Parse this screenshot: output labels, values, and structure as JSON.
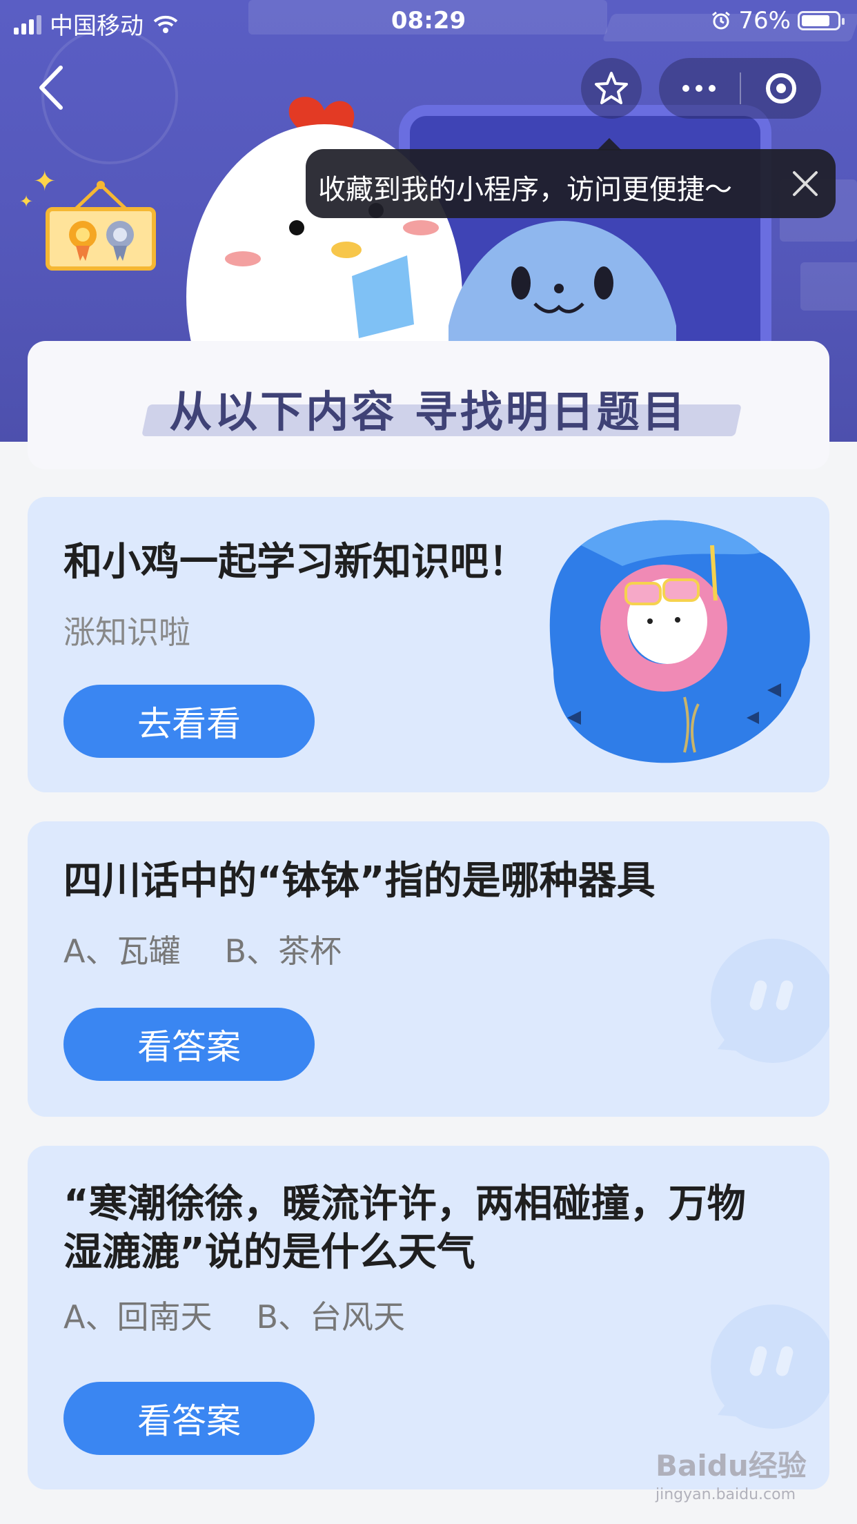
{
  "status_bar": {
    "carrier": "中国移动",
    "time": "08:29",
    "battery": "76%"
  },
  "nav": {
    "tooltip": "收藏到我的小程序，访问更便捷～"
  },
  "banner": {
    "title": "从以下内容  寻找明日题目"
  },
  "cards": [
    {
      "heading": "和小鸡一起学习新知识吧！",
      "subtitle": "涨知识啦",
      "button": "去看看"
    },
    {
      "question": "四川话中的“钵钵”指的是哪种器具",
      "options": [
        "A、瓦罐",
        "B、茶杯"
      ],
      "button": "看答案"
    },
    {
      "question_line1": "“寒潮徐徐，暖流许许，两相碰撞，万物",
      "question_line2": "湿漉漉”说的是什么天气",
      "options": [
        "A、回南天",
        "B、台风天"
      ],
      "button": "看答案"
    }
  ],
  "watermark": {
    "brand": "Baidu经验",
    "url": "jingyan.baidu.com"
  }
}
